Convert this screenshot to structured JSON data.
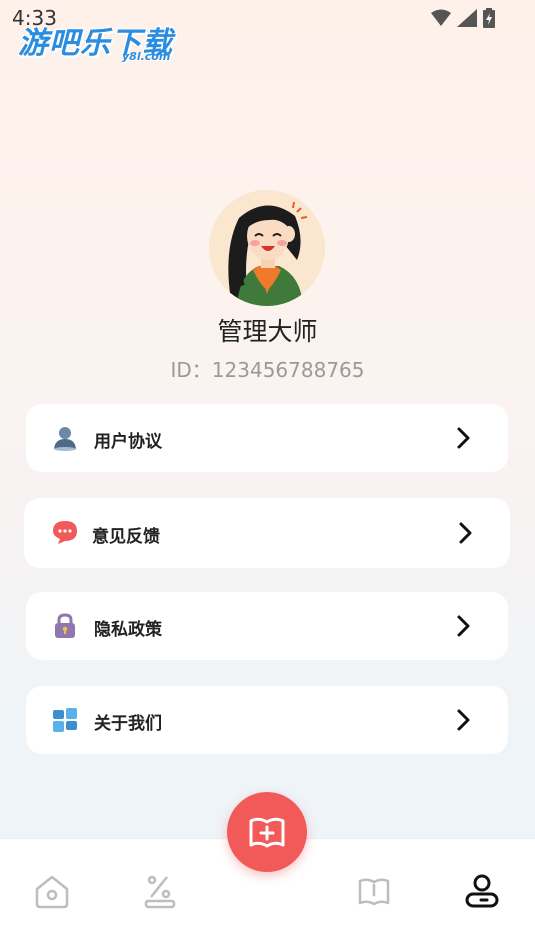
{
  "status_bar": {
    "time": "4:33"
  },
  "watermark": {
    "main": "游吧乐下载",
    "sub": "y8l.com"
  },
  "profile": {
    "name": "管理大师",
    "id_text": "ID：123456788765"
  },
  "menu": [
    {
      "label": "用户协议",
      "icon": "user-agreement-icon"
    },
    {
      "label": "意见反馈",
      "icon": "feedback-icon"
    },
    {
      "label": "隐私政策",
      "icon": "privacy-lock-icon"
    },
    {
      "label": "关于我们",
      "icon": "about-us-icon"
    }
  ],
  "tabs": [
    {
      "icon": "home-icon",
      "active": false
    },
    {
      "icon": "discount-icon",
      "active": false
    },
    {
      "icon": "book-icon",
      "active": false
    },
    {
      "icon": "profile-icon",
      "active": true
    }
  ],
  "colors": {
    "accent": "#f25a5a",
    "icon_inactive": "#bdbdbd",
    "icon_active": "#111111"
  }
}
